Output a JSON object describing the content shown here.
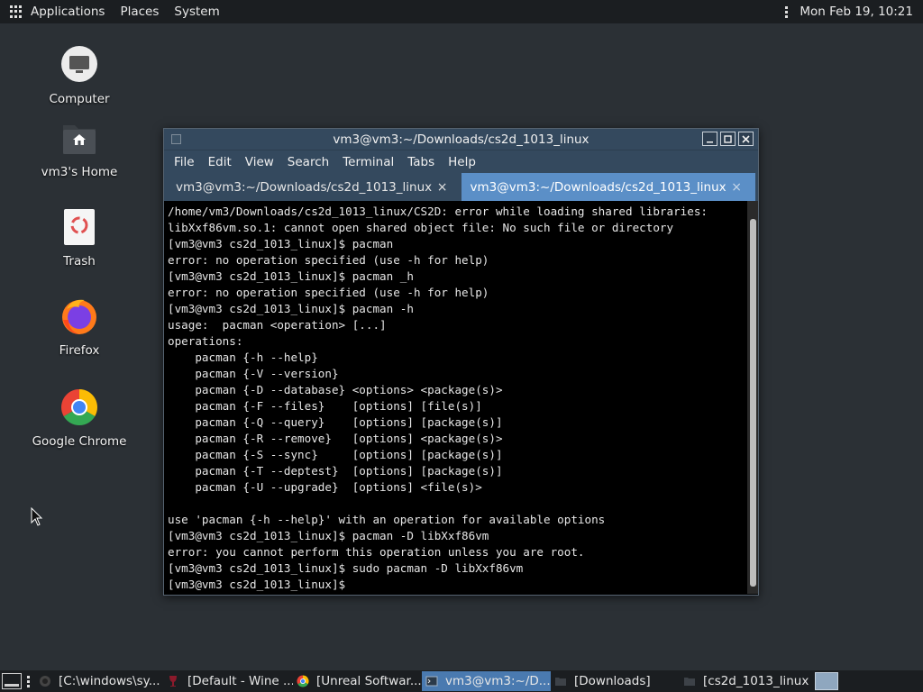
{
  "top_panel": {
    "menus": [
      "Applications",
      "Places",
      "System"
    ],
    "clock": "Mon Feb 19, 10:21"
  },
  "desktop_icons": [
    {
      "label": "Computer",
      "icon": "computer-icon"
    },
    {
      "label": "vm3's Home",
      "icon": "home-folder-icon"
    },
    {
      "label": "Trash",
      "icon": "trash-icon"
    },
    {
      "label": "Firefox",
      "icon": "firefox-icon"
    },
    {
      "label": "Google Chrome",
      "icon": "chrome-icon"
    }
  ],
  "terminal": {
    "title": "vm3@vm3:~/Downloads/cs2d_1013_linux",
    "menu": [
      "File",
      "Edit",
      "View",
      "Search",
      "Terminal",
      "Tabs",
      "Help"
    ],
    "tabs": [
      {
        "label": "vm3@vm3:~/Downloads/cs2d_1013_linux",
        "active": false
      },
      {
        "label": "vm3@vm3:~/Downloads/cs2d_1013_linux",
        "active": true
      }
    ],
    "close_glyph": "×",
    "lines": [
      "/home/vm3/Downloads/cs2d_1013_linux/CS2D: error while loading shared libraries:",
      "libXxf86vm.so.1: cannot open shared object file: No such file or directory",
      "[vm3@vm3 cs2d_1013_linux]$ pacman",
      "error: no operation specified (use -h for help)",
      "[vm3@vm3 cs2d_1013_linux]$ pacman _h",
      "error: no operation specified (use -h for help)",
      "[vm3@vm3 cs2d_1013_linux]$ pacman -h",
      "usage:  pacman <operation> [...]",
      "operations:",
      "    pacman {-h --help}",
      "    pacman {-V --version}",
      "    pacman {-D --database} <options> <package(s)>",
      "    pacman {-F --files}    [options] [file(s)]",
      "    pacman {-Q --query}    [options] [package(s)]",
      "    pacman {-R --remove}   [options] <package(s)>",
      "    pacman {-S --sync}     [options] [package(s)]",
      "    pacman {-T --deptest}  [options] [package(s)]",
      "    pacman {-U --upgrade}  [options] <file(s)>",
      "",
      "use 'pacman {-h --help}' with an operation for available options",
      "[vm3@vm3 cs2d_1013_linux]$ pacman -D libXxf86vm",
      "error: you cannot perform this operation unless you are root.",
      "[vm3@vm3 cs2d_1013_linux]$ sudo pacman -D libXxf86vm",
      "[vm3@vm3 cs2d_1013_linux]$"
    ]
  },
  "taskbar": {
    "items": [
      {
        "label": "[C:\\windows\\sy...",
        "icon": "wine-console-icon",
        "active": false
      },
      {
        "label": "[Default - Wine ...",
        "icon": "wine-glass-icon",
        "active": false
      },
      {
        "label": "[Unreal Softwar...",
        "icon": "chrome-icon",
        "active": false
      },
      {
        "label": "vm3@vm3:~/D...",
        "icon": "terminal-icon",
        "active": true
      },
      {
        "label": "[Downloads]",
        "icon": "folder-icon",
        "active": false
      },
      {
        "label": "[cs2d_1013_linux]",
        "icon": "folder-icon",
        "active": false
      }
    ]
  },
  "colors": {
    "desktop_bg": "#2b3035",
    "panel_bg": "#1b1e21",
    "window_chrome": "#34495e",
    "active_tab": "#5b8fc7",
    "active_task": "#4a7ab0"
  }
}
